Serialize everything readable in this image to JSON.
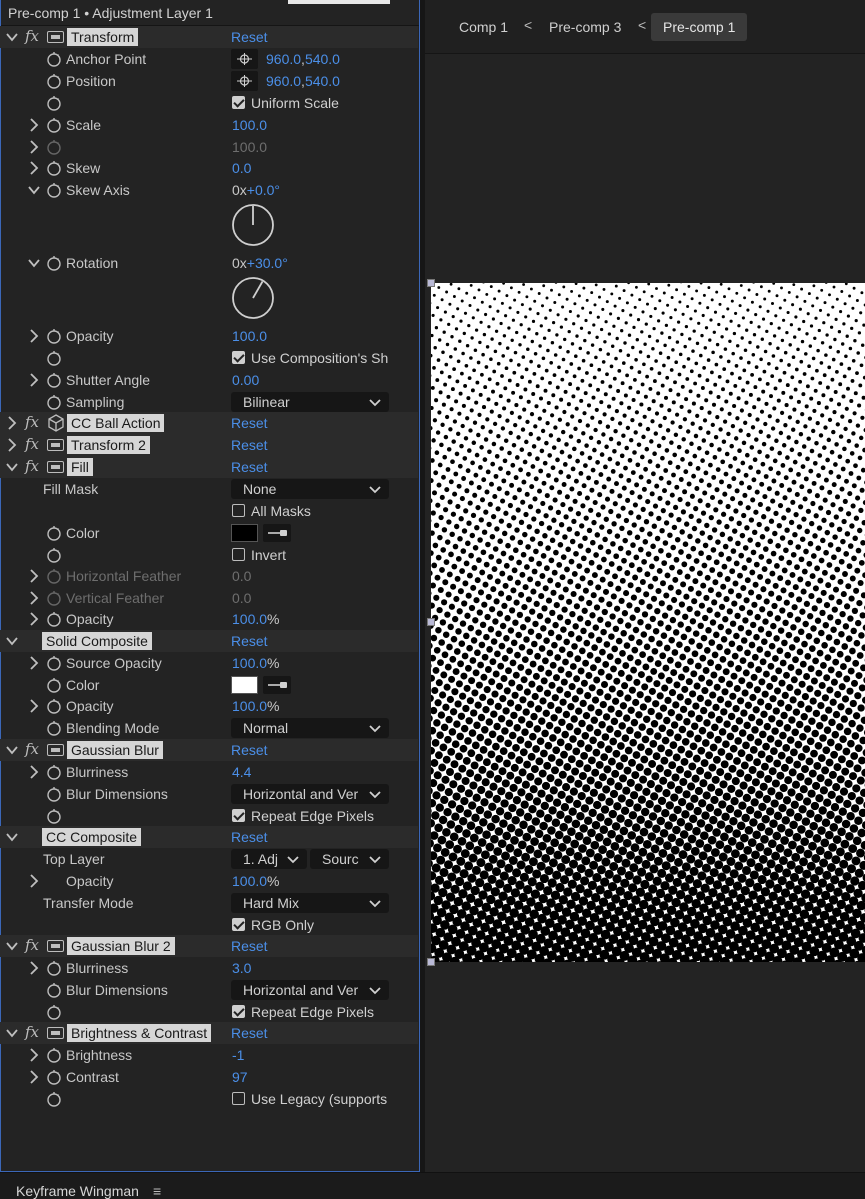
{
  "effect_controls": {
    "title": "Pre-comp 1 • Adjustment Layer 1",
    "reset_label": "Reset",
    "fx_symbol": "fx",
    "effects": {
      "transform": {
        "name": "Transform",
        "anchor_point": {
          "label": "Anchor Point",
          "x": "960.0",
          "y": "540.0",
          "sep": ","
        },
        "position": {
          "label": "Position",
          "x": "960.0",
          "y": "540.0",
          "sep": ","
        },
        "uniform_scale": {
          "label": "Uniform Scale",
          "checked": true
        },
        "scale": {
          "label": "Scale",
          "value": "100.0"
        },
        "scale_disabled": {
          "value": "100.0"
        },
        "skew": {
          "label": "Skew",
          "value": "0.0"
        },
        "skew_axis": {
          "label": "Skew Axis",
          "revs": "0x",
          "deg": "+0.0°",
          "angle_degrees": 0
        },
        "rotation": {
          "label": "Rotation",
          "revs": "0x",
          "deg": "+30.0°",
          "angle_degrees": 30
        },
        "opacity": {
          "label": "Opacity",
          "value": "100.0"
        },
        "use_comp_shutter": {
          "label": "Use Composition's Sh",
          "checked": true
        },
        "shutter_angle": {
          "label": "Shutter Angle",
          "value": "0.00"
        },
        "sampling": {
          "label": "Sampling",
          "value": "Bilinear"
        }
      },
      "cc_ball_action": {
        "name": "CC Ball Action"
      },
      "transform_2": {
        "name": "Transform 2"
      },
      "fill": {
        "name": "Fill",
        "fill_mask": {
          "label": "Fill Mask",
          "value": "None"
        },
        "all_masks": {
          "label": "All Masks",
          "checked": false
        },
        "color": {
          "label": "Color",
          "swatch": "#000000"
        },
        "invert": {
          "label": "Invert",
          "checked": false
        },
        "horizontal_feather": {
          "label": "Horizontal Feather",
          "value": "0.0"
        },
        "vertical_feather": {
          "label": "Vertical Feather",
          "value": "0.0"
        },
        "opacity": {
          "label": "Opacity",
          "value": "100.0",
          "unit": "%"
        }
      },
      "solid_composite": {
        "name": "Solid Composite",
        "source_opacity": {
          "label": "Source Opacity",
          "value": "100.0",
          "unit": "%"
        },
        "color": {
          "label": "Color",
          "swatch": "#ffffff"
        },
        "opacity": {
          "label": "Opacity",
          "value": "100.0",
          "unit": "%"
        },
        "blending_mode": {
          "label": "Blending Mode",
          "value": "Normal"
        }
      },
      "gaussian_blur": {
        "name": "Gaussian Blur",
        "blurriness": {
          "label": "Blurriness",
          "value": "4.4"
        },
        "blur_dimensions": {
          "label": "Blur Dimensions",
          "value": "Horizontal and Ver"
        },
        "repeat_edge_pixels": {
          "label": "Repeat Edge Pixels",
          "checked": true
        }
      },
      "cc_composite": {
        "name": "CC Composite",
        "top_layer": {
          "label": "Top Layer",
          "layer_value": "1. Adj",
          "source_value": "Sourc"
        },
        "opacity": {
          "label": "Opacity",
          "value": "100.0",
          "unit": "%"
        },
        "transfer_mode": {
          "label": "Transfer Mode",
          "value": "Hard Mix"
        },
        "rgb_only": {
          "label": "RGB Only",
          "checked": true
        }
      },
      "gaussian_blur_2": {
        "name": "Gaussian Blur 2",
        "blurriness": {
          "label": "Blurriness",
          "value": "3.0"
        },
        "blur_dimensions": {
          "label": "Blur Dimensions",
          "value": "Horizontal and Ver"
        },
        "repeat_edge_pixels": {
          "label": "Repeat Edge Pixels",
          "checked": true
        }
      },
      "brightness_contrast": {
        "name": "Brightness & Contrast",
        "brightness": {
          "label": "Brightness",
          "value": "-1"
        },
        "contrast": {
          "label": "Contrast",
          "value": "97"
        },
        "use_legacy": {
          "label": "Use Legacy (supports",
          "checked": false
        }
      }
    }
  },
  "composition": {
    "breadcrumbs": [
      "Comp 1",
      "Pre-comp 3",
      "Pre-comp 1"
    ],
    "separator": "<",
    "active_index": 2
  },
  "bottom_panel": {
    "title": "Keyframe Wingman",
    "menu_glyph": "≡"
  },
  "colors": {
    "accent_blue": "#4b8fe8",
    "panel_bg": "#232323",
    "focus_border": "#3b67b8"
  }
}
